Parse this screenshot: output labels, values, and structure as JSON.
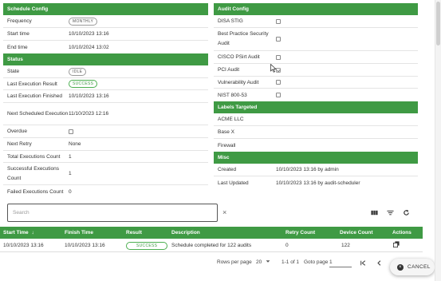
{
  "schedule_config": {
    "header": "Schedule Config",
    "frequency_label": "Frequency",
    "frequency_value": "MONTHLY",
    "start_time_label": "Start time",
    "start_time_value": "10/10/2023 13:16",
    "end_time_label": "End time",
    "end_time_value": "10/10/2024 13:02"
  },
  "status": {
    "header": "Status",
    "state_label": "State",
    "state_value": "IDLE",
    "last_result_label": "Last Execution Result",
    "last_result_value": "SUCCESS",
    "last_finished_label": "Last Execution Finished",
    "last_finished_value": "10/10/2023 13:16",
    "next_scheduled_label": "Next Scheduled Execution",
    "next_scheduled_value": "11/10/2023 12:16",
    "overdue_label": "Overdue",
    "overdue_checked": false,
    "next_retry_label": "Next Retry",
    "next_retry_value": "None",
    "total_exec_label": "Total Executions Count",
    "total_exec_value": "1",
    "success_exec_label": "Successful Executions Count",
    "success_exec_value": "1",
    "failed_exec_label": "Failed Executions Count",
    "failed_exec_value": "0"
  },
  "audit_config": {
    "header": "Audit Config",
    "items": [
      {
        "label": "DISA STIG",
        "checked": false
      },
      {
        "label": "Best Practice Security Audit",
        "checked": false
      },
      {
        "label": "CISCO PSirt Audit",
        "checked": false
      },
      {
        "label": "PCI Audit",
        "checked": true
      },
      {
        "label": "Vulnerability Audit",
        "checked": false
      },
      {
        "label": "NIST 800-53",
        "checked": false
      }
    ]
  },
  "labels_targeted": {
    "header": "Labels Targeted",
    "items": [
      "ACME LLC",
      "Base X",
      "Firewall"
    ]
  },
  "misc": {
    "header": "Misc",
    "created_label": "Created",
    "created_value": "10/10/2023 13:16 by admin",
    "updated_label": "Last Updated",
    "updated_value": "10/10/2023 13:16 by audit-scheduler"
  },
  "search": {
    "placeholder": "Search",
    "clear_glyph": "×"
  },
  "toolbar": {
    "columns_icon": "columns-icon",
    "filter_icon": "filter-icon",
    "refresh_icon": "refresh-icon"
  },
  "table": {
    "columns": {
      "start_time": "Start Time",
      "sort_arrow": "↓",
      "finish_time": "Finish Time",
      "result": "Result",
      "description": "Description",
      "retry_count": "Retry Count",
      "device_count": "Device Count",
      "actions": "Actions"
    },
    "rows": [
      {
        "start_time": "10/10/2023 13:16",
        "finish_time": "10/10/2023 13:16",
        "result": "SUCCESS",
        "description": "Schedule completed for 122 audits",
        "retry_count": "0",
        "device_count": "122"
      }
    ]
  },
  "pagination": {
    "rows_per_page_label": "Rows per page",
    "rows_per_page_value": "20",
    "range": "1-1 of 1",
    "goto_label": "Goto page",
    "goto_value": "1"
  },
  "cancel_button": {
    "label": "CANCEL"
  },
  "colors": {
    "header_green": "#3f9a44",
    "success_green": "#4caf50"
  }
}
